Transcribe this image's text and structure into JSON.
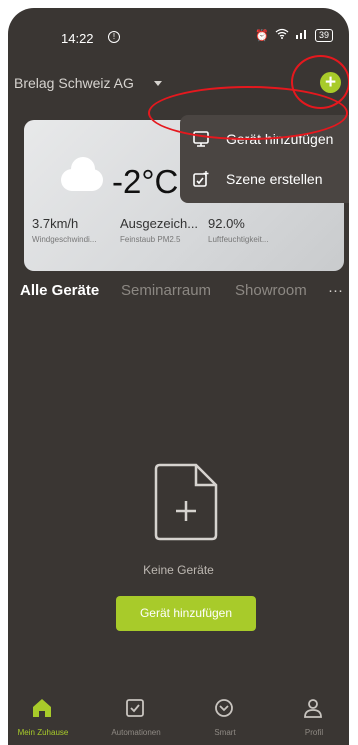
{
  "status_bar": {
    "time": "14:22",
    "battery": "39"
  },
  "home": {
    "title": "Brelag Schweiz AG"
  },
  "weather": {
    "temperature": "-2°C",
    "stats": [
      {
        "value": "3.7km/h",
        "label": "Windgeschwindi..."
      },
      {
        "value": "Ausgezeich...",
        "label": "Feinstaub PM2.5"
      },
      {
        "value": "92.0%",
        "label": "Luftfeuchtigkeit..."
      }
    ]
  },
  "menu": [
    {
      "label": "Gerät hinzufügen",
      "icon": "add-device-icon"
    },
    {
      "label": "Szene erstellen",
      "icon": "create-scene-icon"
    }
  ],
  "tabs": [
    "Alle Geräte",
    "Seminarraum",
    "Showroom"
  ],
  "empty": {
    "label": "Keine Geräte",
    "button": "Gerät hinzufügen"
  },
  "bottom_nav": [
    {
      "label": "Mein Zuhause",
      "icon": "home-icon",
      "active": true
    },
    {
      "label": "Automationen",
      "icon": "checkbox-icon",
      "active": false
    },
    {
      "label": "Smart",
      "icon": "smart-icon",
      "active": false
    },
    {
      "label": "Profil",
      "icon": "profile-icon",
      "active": false
    }
  ],
  "colors": {
    "accent": "#a8cb2a",
    "background": "#3a3633",
    "highlight": "#e5181e"
  }
}
